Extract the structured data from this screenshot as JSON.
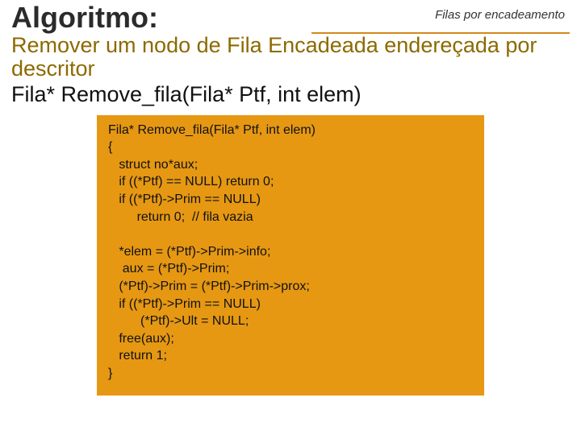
{
  "header": {
    "title": "Algoritmo:",
    "topic": "Filas por encadeamento"
  },
  "subtitle": {
    "line1": "Remover um nodo de Fila Encadeada endereçada por descritor",
    "line2": "Fila* Remove_fila(Fila* Ptf, int elem)"
  },
  "code": "Fila* Remove_fila(Fila* Ptf, int elem)\n{\n   struct no*aux;\n   if ((*Ptf) == NULL) return 0;\n   if ((*Ptf)->Prim == NULL)\n        return 0;  // fila vazia\n\n   *elem = (*Ptf)->Prim->info;\n    aux = (*Ptf)->Prim;\n   (*Ptf)->Prim = (*Ptf)->Prim->prox;\n   if ((*Ptf)->Prim == NULL)\n         (*Ptf)->Ult = NULL;\n   free(aux);\n   return 1;\n}"
}
